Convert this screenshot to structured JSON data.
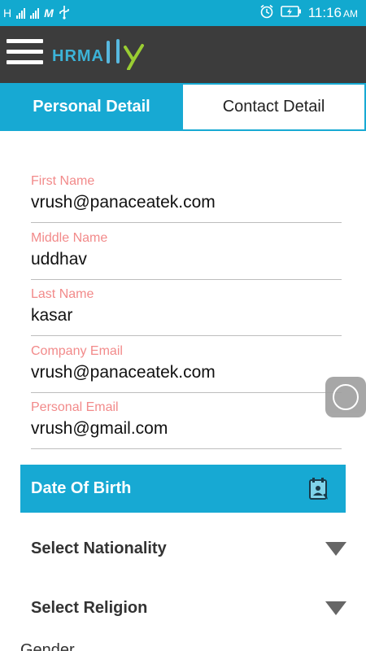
{
  "status_bar": {
    "network_label": "H",
    "carrier_label": "M",
    "time": "11:16",
    "ampm": "AM",
    "icons": [
      "signal-icon",
      "signal-icon",
      "gmail-icon",
      "usb-icon",
      "alarm-icon",
      "battery-charging-icon"
    ]
  },
  "app_bar": {
    "logo_text": "HRMA",
    "logo_suffix": "lly"
  },
  "tabs": [
    {
      "label": "Personal Detail",
      "active": true
    },
    {
      "label": "Contact Detail",
      "active": false
    }
  ],
  "form": {
    "first_name": {
      "label": "First Name",
      "value": "vrush@panaceatek.com"
    },
    "middle_name": {
      "label": "Middle Name",
      "value": "uddhav"
    },
    "last_name": {
      "label": "Last Name",
      "value": "kasar"
    },
    "company_email": {
      "label": "Company Email",
      "value": "vrush@panaceatek.com"
    },
    "personal_email": {
      "label": "Personal Email",
      "value": "vrush@gmail.com"
    }
  },
  "date_of_birth": {
    "label": "Date Of Birth",
    "icon": "calendar-icon"
  },
  "selects": {
    "nationality": {
      "label": "Select Nationality"
    },
    "religion": {
      "label": "Select Religion"
    }
  },
  "partial_label": "Gender",
  "colors": {
    "accent": "#17a9d3",
    "status_bar": "#12a9cf",
    "app_bar": "#3c3c3c",
    "field_label": "#f28a8a"
  }
}
